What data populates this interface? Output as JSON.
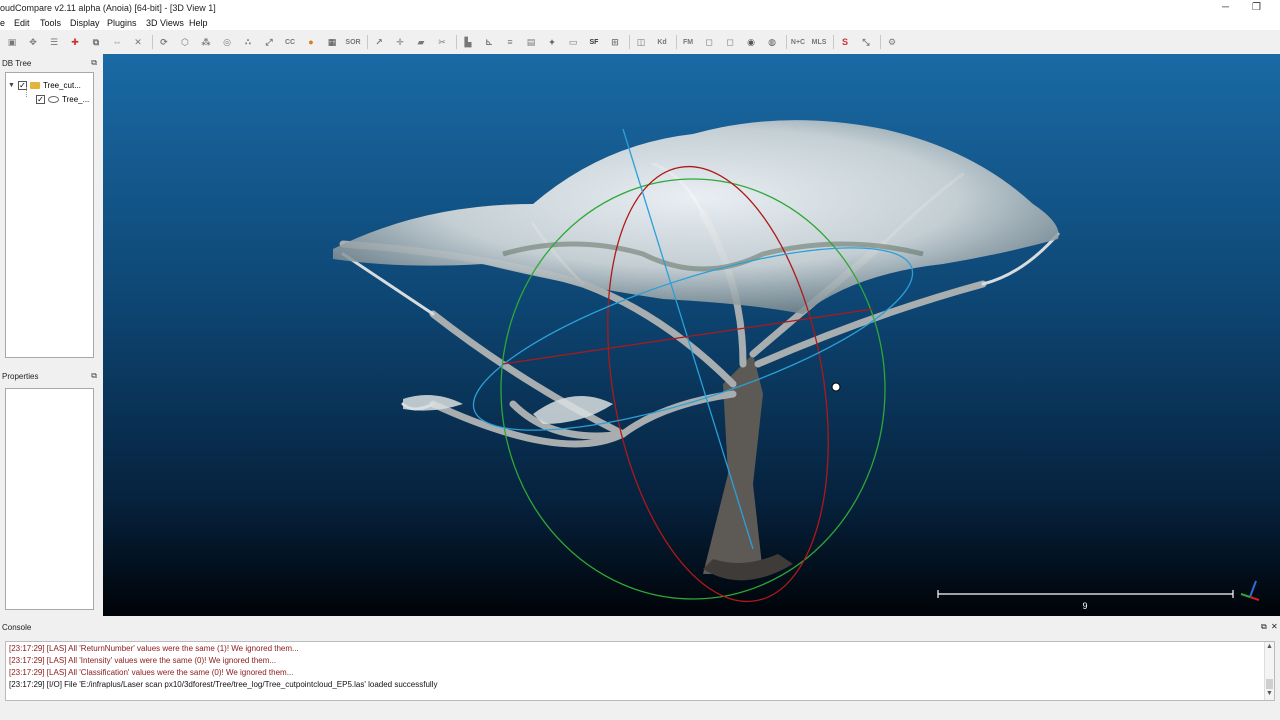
{
  "window": {
    "title": "oudCompare v2.11 alpha (Anoia) [64-bit] - [3D View 1]",
    "minimize": "─",
    "restore": "❐"
  },
  "menu": [
    "e",
    "Edit",
    "Tools",
    "Display",
    "Plugins",
    "3D Views",
    "Help"
  ],
  "toolbar": {
    "buttons": [
      {
        "name": "save-icon",
        "glyph": "▣"
      },
      {
        "name": "translate-rotate-icon",
        "glyph": "✥"
      },
      {
        "name": "list-icon",
        "glyph": "☰"
      },
      {
        "name": "add-point-icon",
        "glyph": "✚",
        "color": "#d03030"
      },
      {
        "name": "clone-icon",
        "glyph": "⧉"
      },
      {
        "name": "merge-icon",
        "glyph": "⇔"
      },
      {
        "name": "delete-icon",
        "glyph": "✕"
      },
      {
        "name": "sample-icon",
        "glyph": "⟳"
      },
      {
        "name": "segment-icon",
        "glyph": "⬡"
      },
      {
        "name": "subsample-icon",
        "glyph": "⁂"
      },
      {
        "name": "normals-icon",
        "glyph": "◎"
      },
      {
        "name": "scatter-icon",
        "glyph": "∴"
      },
      {
        "name": "cross-section-icon",
        "glyph": "⤢"
      },
      {
        "name": "cc-label-icon",
        "glyph": "CC"
      },
      {
        "name": "mesh-icon",
        "glyph": "●",
        "color": "#d08020"
      },
      {
        "name": "checkerboard-icon",
        "glyph": "▦",
        "color": "#444"
      },
      {
        "name": "sor-icon",
        "glyph": "SOR"
      },
      {
        "name": "pick-icon",
        "glyph": "↗"
      },
      {
        "name": "move-icon",
        "glyph": "✛"
      },
      {
        "name": "plane-icon",
        "glyph": "▰"
      },
      {
        "name": "cut-icon",
        "glyph": "✂"
      },
      {
        "name": "histogram-icon",
        "glyph": "▙"
      },
      {
        "name": "axes-icon",
        "glyph": "⊾"
      },
      {
        "name": "filter-icon",
        "glyph": "≡"
      },
      {
        "name": "table-icon",
        "glyph": "▤"
      },
      {
        "name": "plus-icon",
        "glyph": "+",
        "color": "#333"
      },
      {
        "name": "box-icon",
        "glyph": "▭"
      },
      {
        "name": "sf-icon",
        "glyph": "SF",
        "color": "#333"
      },
      {
        "name": "compute-icon",
        "glyph": "⊞"
      },
      {
        "name": "classify-icon",
        "glyph": "◫"
      },
      {
        "name": "kd-label-icon",
        "glyph": "Kd"
      },
      {
        "name": "fm-label-icon",
        "glyph": "FM"
      },
      {
        "name": "paste-icon",
        "glyph": "◻"
      },
      {
        "name": "copy-icon",
        "glyph": "◻"
      },
      {
        "name": "sphere-icon",
        "glyph": "◉",
        "color": "#555"
      },
      {
        "name": "globe-icon",
        "glyph": "◍",
        "color": "#555"
      },
      {
        "name": "n-c-label-icon",
        "glyph": "N+C"
      },
      {
        "name": "mls-label-icon",
        "glyph": "MLS"
      },
      {
        "name": "s-curve-icon",
        "glyph": "S",
        "color": "#d03030"
      },
      {
        "name": "scale-icon",
        "glyph": "⤡"
      },
      {
        "name": "plugin-icon",
        "glyph": "⚙"
      }
    ]
  },
  "db_tree": {
    "title": "DB Tree",
    "items": [
      {
        "label": "Tree_cut..."
      },
      {
        "label": "Tree_..."
      }
    ]
  },
  "properties": {
    "title": "Properties"
  },
  "view3d": {
    "scale_label": "9"
  },
  "console": {
    "title": "Console",
    "lines": [
      {
        "text": "[23:17:29] [LAS] All 'ReturnNumber' values were the same (1)! We ignored them...",
        "color": "#8b1a1a"
      },
      {
        "text": "[23:17:29] [LAS] All 'Intensity' values were the same (0)! We ignored them...",
        "color": "#8b1a1a"
      },
      {
        "text": "[23:17:29] [LAS] All 'Classification' values were the same (0)! We ignored them...",
        "color": "#8b1a1a"
      },
      {
        "text": "[23:17:29] [I/O] File 'E:/infraplus/Laser scan px10/3dforest/Tree/tree_log/Tree_cutpointcloud_EP5.las' loaded successfully",
        "color": "#111111"
      }
    ]
  }
}
